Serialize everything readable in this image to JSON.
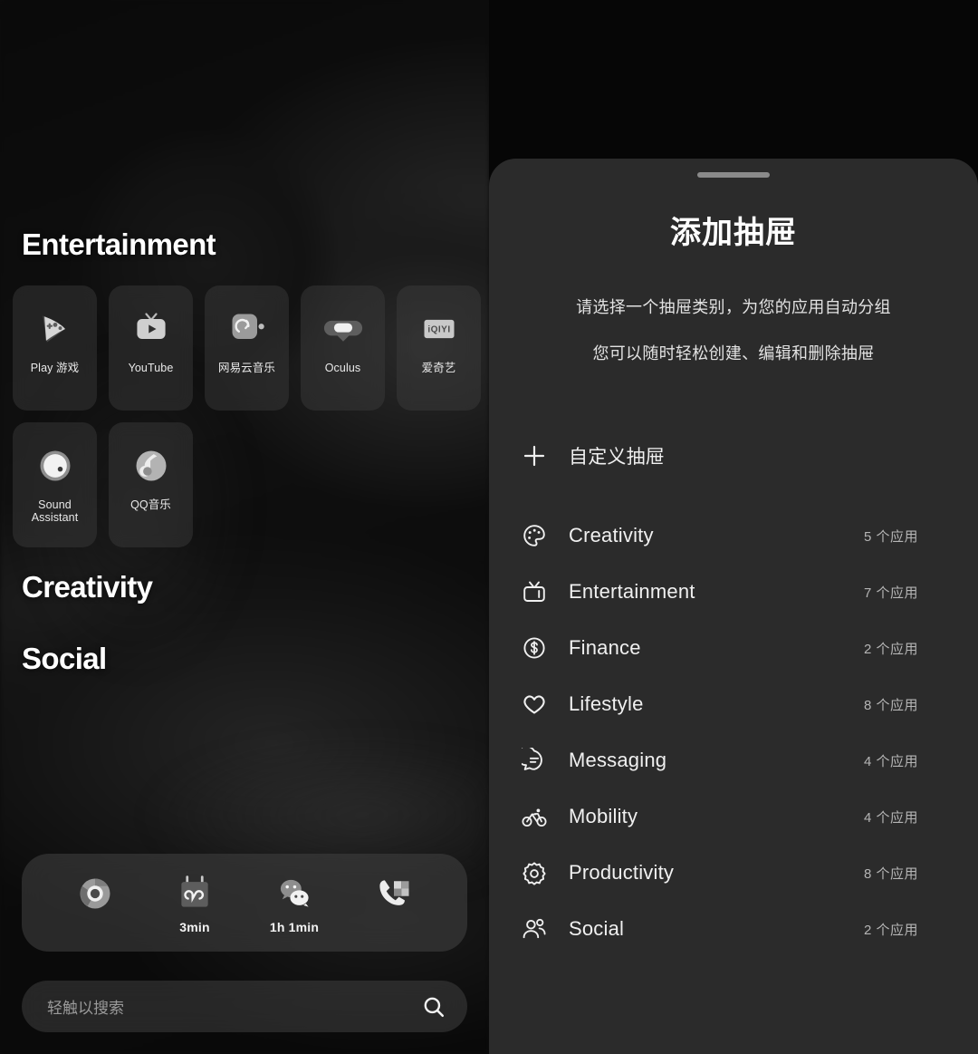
{
  "home": {
    "sections": [
      {
        "id": "entertainment",
        "title": "Entertainment"
      },
      {
        "id": "creativity",
        "title": "Creativity"
      },
      {
        "id": "social",
        "title": "Social"
      }
    ],
    "apps_row1": [
      {
        "label": "Play 游戏",
        "icon": "google-play-games-icon"
      },
      {
        "label": "YouTube",
        "icon": "youtube-icon"
      },
      {
        "label": "网易云音乐",
        "icon": "netease-cloud-music-icon"
      },
      {
        "label": "Oculus",
        "icon": "oculus-icon"
      },
      {
        "label": "爱奇艺",
        "icon": "iqiyi-icon"
      }
    ],
    "apps_row2": [
      {
        "label": "Sound Assistant",
        "icon": "sound-assistant-icon"
      },
      {
        "label": "QQ音乐",
        "icon": "qq-music-icon"
      }
    ],
    "dock": [
      {
        "icon": "chrome-icon",
        "timer": ""
      },
      {
        "icon": "calendar-icon",
        "timer": "3min"
      },
      {
        "icon": "wechat-icon",
        "timer": "1h 1min"
      },
      {
        "icon": "phone-contacts-icon",
        "timer": ""
      }
    ],
    "search": {
      "placeholder": "轻触以搜索",
      "icon": "search-icon"
    }
  },
  "sheet": {
    "title": "添加抽屉",
    "subtitle_line1": "请选择一个抽屉类别，为您的应用自动分组",
    "subtitle_line2": "您可以随时轻松创建、编辑和删除抽屉",
    "custom": {
      "label": "自定义抽屉",
      "icon": "plus-icon"
    },
    "categories": [
      {
        "name": "Creativity",
        "count": "5 个应用",
        "icon": "palette-icon"
      },
      {
        "name": "Entertainment",
        "count": "7 个应用",
        "icon": "tv-icon"
      },
      {
        "name": "Finance",
        "count": "2 个应用",
        "icon": "dollar-coin-icon"
      },
      {
        "name": "Lifestyle",
        "count": "8 个应用",
        "icon": "heart-icon"
      },
      {
        "name": "Messaging",
        "count": "4 个应用",
        "icon": "chat-bubble-icon"
      },
      {
        "name": "Mobility",
        "count": "4 个应用",
        "icon": "bicycle-icon"
      },
      {
        "name": "Productivity",
        "count": "8 个应用",
        "icon": "gear-icon"
      },
      {
        "name": "Social",
        "count": "2 个应用",
        "icon": "people-icon"
      }
    ]
  },
  "colors": {
    "sheet_bg": "#2b2b2b",
    "home_bg": "#0d0d0d",
    "text_primary": "#ffffff",
    "text_secondary": "#b5b5b5",
    "tile_bg": "rgba(62,62,62,.45)"
  }
}
